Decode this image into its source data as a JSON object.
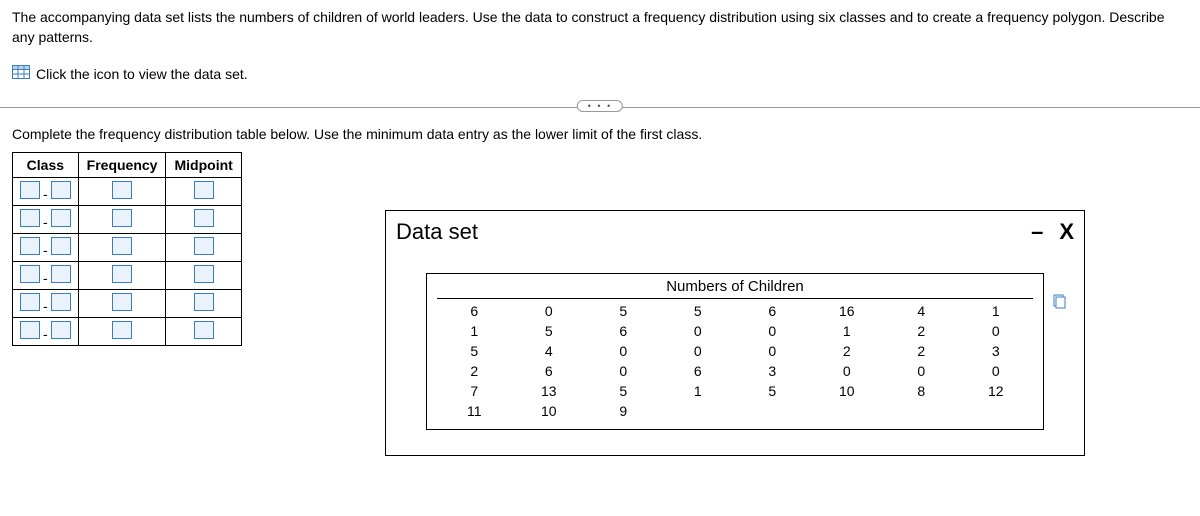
{
  "header": {
    "problem_text": "The accompanying data set lists the numbers of children of world leaders. Use the data to construct a frequency distribution using six classes and to create a frequency polygon. Describe any patterns.",
    "click_icon_text": "Click the icon to view the data set."
  },
  "instruction2": "Complete the frequency distribution table below. Use the minimum data entry as the lower limit of the first class.",
  "freq_table": {
    "headers": [
      "Class",
      "Frequency",
      "Midpoint"
    ]
  },
  "popup": {
    "title": "Data set",
    "minimize": "–",
    "close": "X",
    "data_title": "Numbers of Children",
    "rows": [
      [
        "6",
        "0",
        "5",
        "5",
        "6",
        "16",
        "4",
        "1"
      ],
      [
        "1",
        "5",
        "6",
        "0",
        "0",
        "1",
        "2",
        "0"
      ],
      [
        "5",
        "4",
        "0",
        "0",
        "0",
        "2",
        "2",
        "3"
      ],
      [
        "2",
        "6",
        "0",
        "6",
        "3",
        "0",
        "0",
        "0"
      ],
      [
        "7",
        "13",
        "5",
        "1",
        "5",
        "10",
        "8",
        "12"
      ],
      [
        "11",
        "10",
        "9",
        "",
        "",
        "",
        "",
        ""
      ]
    ]
  },
  "ellipsis": "• • •"
}
